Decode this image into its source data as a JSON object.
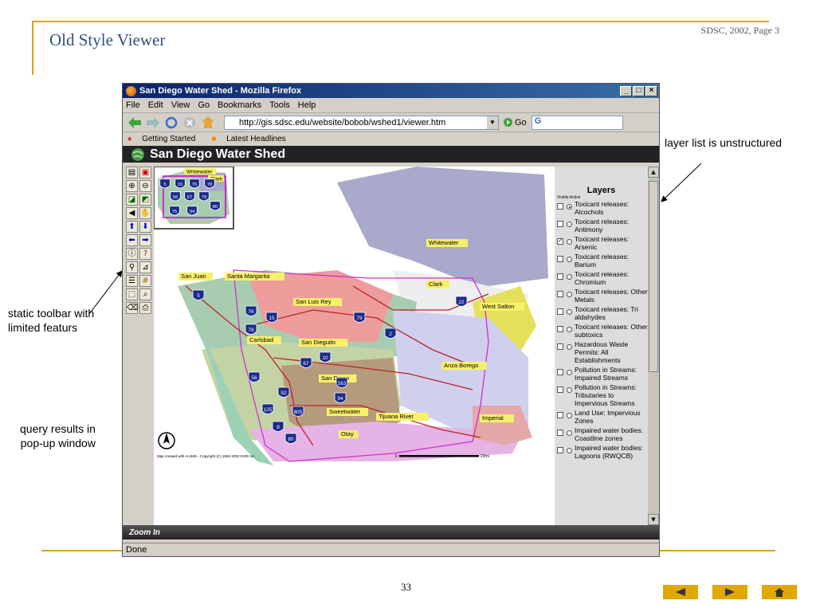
{
  "slide": {
    "title": "Old Style Viewer",
    "credit": "SDSC, 2002, Page 3",
    "page_number": "33",
    "callouts": {
      "layer_list": "layer list is unstructured",
      "toolbar_line1": "static toolbar with",
      "toolbar_line2": "limited featurs",
      "query_line1": "query results in",
      "query_line2": "pop-up window"
    }
  },
  "browser": {
    "title": "San Diego Water Shed - Mozilla Firefox",
    "menus": [
      "File",
      "Edit",
      "View",
      "Go",
      "Bookmarks",
      "Tools",
      "Help"
    ],
    "url": "http://gis.sdsc.edu/website/bobob/wshed1/viewer.htm",
    "go_label": "Go",
    "search_value": "G",
    "bookmarks": [
      "Getting Started",
      "Latest Headlines"
    ],
    "status": "Done"
  },
  "app": {
    "title": "San Diego Water Shed",
    "status_label": "Zoom In",
    "layers_title": "Layers",
    "layers_sub": "Visible Active",
    "layers": [
      {
        "name": "Toxicant releases: Alcochols",
        "visible": false,
        "active": true
      },
      {
        "name": "Toxicant releases: Antimony",
        "visible": false,
        "active": false
      },
      {
        "name": "Toxicant releases: Arsenic",
        "visible": true,
        "active": false
      },
      {
        "name": "Toxicant releases: Barium",
        "visible": false,
        "active": false
      },
      {
        "name": "Toxicant releases: Chromium",
        "visible": false,
        "active": false
      },
      {
        "name": "Toxicant releases: Other Metals",
        "visible": false,
        "active": false
      },
      {
        "name": "Toxicant releases: Tri aldahydes",
        "visible": false,
        "active": false
      },
      {
        "name": "Toxicant releases: Other subtoxics",
        "visible": false,
        "active": false
      },
      {
        "name": "Hazardous Waste Permits: All Establishments",
        "visible": false,
        "active": false
      },
      {
        "name": "Pollution in Streams: Impaired Streams",
        "visible": false,
        "active": false
      },
      {
        "name": "Pollution in Streams: Tributaries to Impervious Streams",
        "visible": false,
        "active": false
      },
      {
        "name": "Land Use: Impervious Zones",
        "visible": false,
        "active": false
      },
      {
        "name": "Impaired water bodies: Coastline zones",
        "visible": false,
        "active": false
      },
      {
        "name": "Impaired water bodies: Lagoons (RWQCB)",
        "visible": false,
        "active": false
      }
    ],
    "map": {
      "copyright": "Map created with ArcIMS - Copyright (C) 1992-2002 ESRI Inc.",
      "scale_start": "0",
      "scale_end": "23mi",
      "places": [
        "Whitewater",
        "Clark",
        "San Juan",
        "Santa Margarita",
        "San Luis Rey",
        "West Salton",
        "Carlsbad",
        "San Dieguito",
        "San Diego",
        "Anza Borego",
        "Sweetwater",
        "Tijuana River",
        "Otay",
        "Imperial"
      ],
      "highways": [
        "5",
        "76",
        "15",
        "78",
        "79",
        "22",
        "2",
        "10",
        "56",
        "52",
        "67",
        "163",
        "125",
        "805",
        "94",
        "8",
        "80"
      ],
      "overview_places": [
        "Whitewater",
        "Clark"
      ],
      "overview_highways": [
        "5",
        "15",
        "76",
        "78",
        "56",
        "67",
        "79",
        "75",
        "94",
        "80"
      ]
    }
  },
  "colors": {
    "accent": "#dda200",
    "title": "#2f4f7f",
    "shield": "#1b2a8a"
  }
}
